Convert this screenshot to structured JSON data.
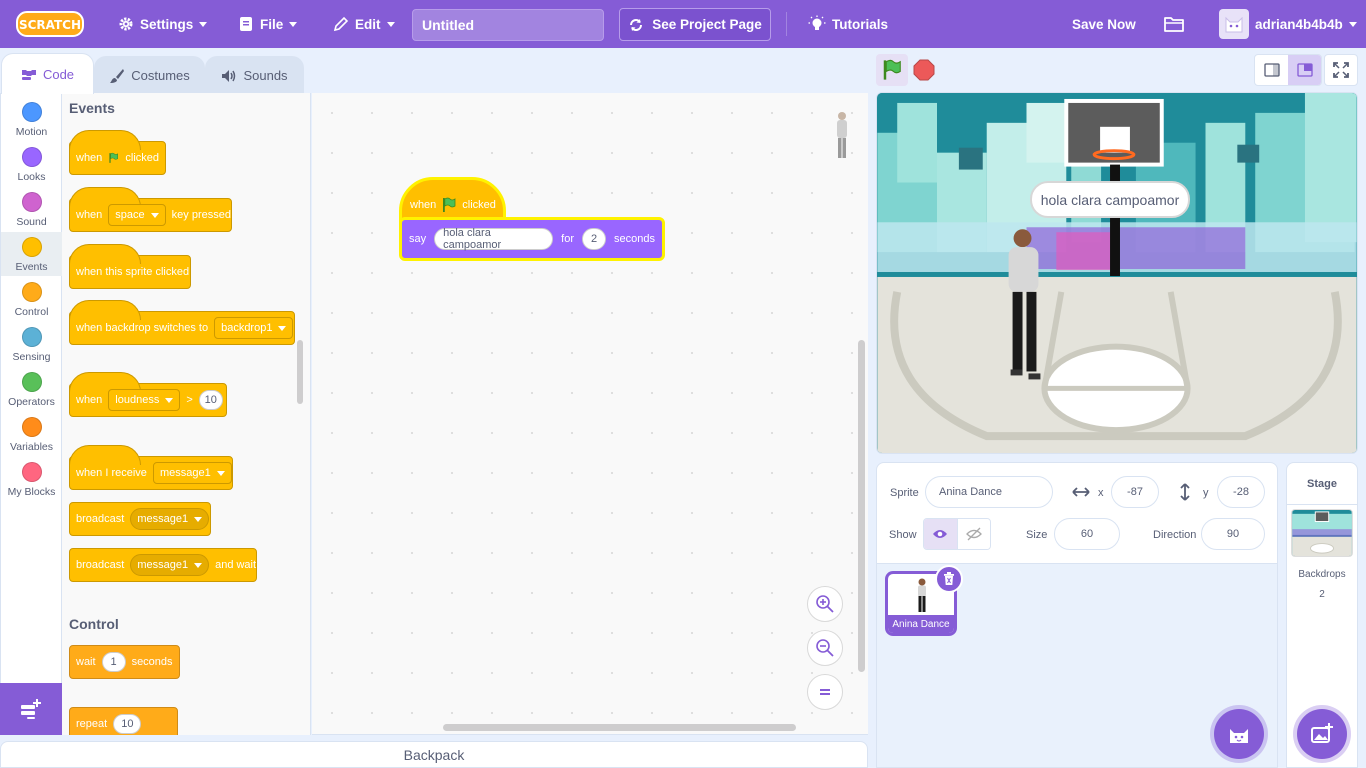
{
  "menubar": {
    "logo": "SCRATCH",
    "settings": "Settings",
    "file": "File",
    "edit": "Edit",
    "project_title": "Untitled",
    "see_project_page": "See Project Page",
    "tutorials": "Tutorials",
    "save_now": "Save Now",
    "username": "adrian4b4b4b"
  },
  "tabs": {
    "code": "Code",
    "costumes": "Costumes",
    "sounds": "Sounds"
  },
  "categories": [
    {
      "label": "Motion",
      "color": "#4c97ff"
    },
    {
      "label": "Looks",
      "color": "#9966ff"
    },
    {
      "label": "Sound",
      "color": "#cf63cf"
    },
    {
      "label": "Events",
      "color": "#ffbf00"
    },
    {
      "label": "Control",
      "color": "#ffab19"
    },
    {
      "label": "Sensing",
      "color": "#5cb1d6"
    },
    {
      "label": "Operators",
      "color": "#59c059"
    },
    {
      "label": "Variables",
      "color": "#ff8c1a"
    },
    {
      "label": "My Blocks",
      "color": "#ff6680"
    }
  ],
  "flyout": {
    "events_label": "Events",
    "control_label": "Control",
    "when": "when",
    "clicked": "clicked",
    "key_option": "space",
    "key_pressed": "key pressed",
    "when_sprite_clicked": "when this sprite clicked",
    "when_backdrop_switches": "when backdrop switches to",
    "backdrop_option": "backdrop1",
    "loudness_option": "loudness",
    "gt": ">",
    "loudness_value": "10",
    "when_i_receive": "when I receive",
    "message_option": "message1",
    "broadcast": "broadcast",
    "and_wait": "and wait",
    "wait": "wait",
    "wait_value": "1",
    "seconds": "seconds",
    "repeat": "repeat",
    "repeat_value": "10"
  },
  "script": {
    "when": "when",
    "clicked": "clicked",
    "say": "say",
    "message": "hola clara campoamor",
    "for": "for",
    "duration": "2",
    "seconds": "seconds"
  },
  "backpack": "Backpack",
  "stage": {
    "speech": "hola clara campoamor"
  },
  "sprite_info": {
    "sprite_label": "Sprite",
    "sprite_name": "Anina Dance",
    "x_label": "x",
    "x_value": "-87",
    "y_label": "y",
    "y_value": "-28",
    "show_label": "Show",
    "size_label": "Size",
    "size_value": "60",
    "direction_label": "Direction",
    "direction_value": "90"
  },
  "sprites": [
    {
      "name": "Anina Dance"
    }
  ],
  "stage_pane": {
    "title": "Stage",
    "backdrops_label": "Backdrops",
    "backdrops_count": "2"
  },
  "colors": {
    "menu": "#855cd6",
    "events": "#ffbf00",
    "looks": "#9966ff",
    "highlight": "#fff200"
  }
}
